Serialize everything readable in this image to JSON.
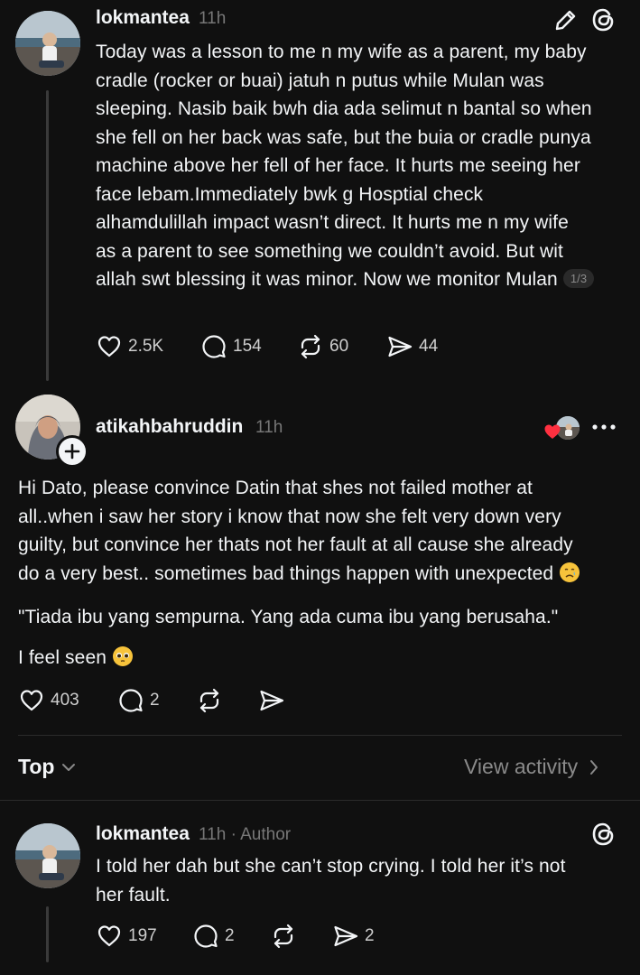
{
  "post": {
    "username": "lokmantea",
    "time": "11h",
    "lines": [
      "Today was a lesson to me n my wife as a parent, my baby",
      "cradle (rocker or buai) jatuh n putus while Mulan was",
      "sleeping. Nasib baik bwh dia ada selimut n bantal so when",
      "she fell on her back was safe, but the buia or cradle punya",
      "machine above her fell of her face. It hurts me seeing her",
      "face lebam.Immediately bwk g Hosptial check",
      "alhamdulillah impact wasn’t direct. It hurts me n my wife",
      "as a parent to see something we couldn’t avoid. But wit",
      "allah swt blessing it was minor. Now we monitor Mulan"
    ],
    "pager": "1/3",
    "likes": "2.5K",
    "replies": "154",
    "reposts": "60",
    "shares": "44"
  },
  "reply1": {
    "username": "atikahbahruddin",
    "time": "11h",
    "lines": [
      "Hi Dato, please convince Datin that shes not failed mother at",
      "all..when i saw her story i know that now she felt very down very",
      "guilty, but convince her thats not her fault at all cause she already",
      "do a very best.. sometimes bad things happen with unexpected"
    ],
    "quote": "\"Tiada ibu yang sempurna. Yang ada cuma ibu yang berusaha.\"",
    "seen": "I feel seen",
    "likes": "403",
    "replies": "2"
  },
  "sort": {
    "label": "Top",
    "activity": "View activity"
  },
  "reply2": {
    "username": "lokmantea",
    "time": "11h",
    "author_tag": "· Author",
    "lines": [
      "I told her dah but she can’t stop crying.  I told her it’s not",
      "her fault."
    ],
    "likes": "197",
    "replies": "2",
    "shares": "2"
  },
  "icons": {
    "edit": "pencil-icon",
    "threads": "threads-logo-icon",
    "like": "heart-icon",
    "reply": "comment-icon",
    "repost": "repost-icon",
    "share": "send-icon",
    "more": "more-icon",
    "follow": "plus-icon",
    "chevron": "chevron-down-icon",
    "arrow": "chevron-right-icon"
  },
  "colors": {
    "background": "#101010",
    "text": "#f3f5f7",
    "muted": "#777777",
    "heart_red": "#ff3040"
  }
}
